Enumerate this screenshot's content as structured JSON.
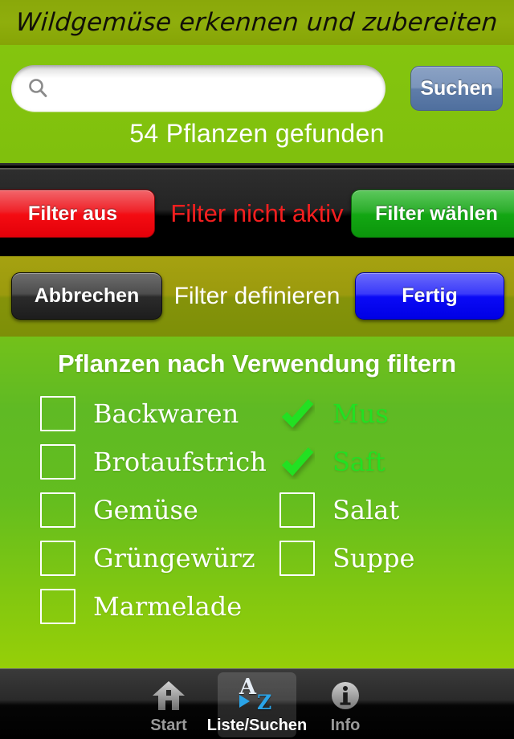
{
  "window": {
    "title": "Wildgemüse erkennen und zubereiten"
  },
  "search": {
    "input_value": "",
    "placeholder": "",
    "icon": "search-icon",
    "button_label": "Suchen",
    "results_text": "54 Pflanzen gefunden"
  },
  "filter_status_bar": {
    "off_button_label": "Filter aus",
    "status_text": "Filter nicht aktiv",
    "choose_button_label": "Filter wählen",
    "status_color": "#f31f1f",
    "off_button_color": "#ef2229",
    "choose_button_color": "#2bae2b"
  },
  "filter_define_bar": {
    "cancel_label": "Abbrechen",
    "title": "Filter definieren",
    "done_label": "Fertig",
    "done_button_color": "#0a0af6"
  },
  "filter_panel": {
    "heading": "Pflanzen nach Verwendung filtern",
    "checked_color": "#22e022",
    "columns": [
      {
        "options": [
          {
            "label": "Backwaren",
            "checked": false
          },
          {
            "label": "Brotaufstrich",
            "checked": false
          },
          {
            "label": "Gemüse",
            "checked": false
          },
          {
            "label": "Grüngewürz",
            "checked": false
          },
          {
            "label": "Marmelade",
            "checked": false
          }
        ]
      },
      {
        "options": [
          {
            "label": "Mus",
            "checked": true
          },
          {
            "label": "Saft",
            "checked": true
          },
          {
            "label": "Salat",
            "checked": false
          },
          {
            "label": "Suppe",
            "checked": false
          }
        ]
      }
    ]
  },
  "tabbar": {
    "tabs": [
      {
        "label": "Start",
        "icon": "home-icon",
        "active": false
      },
      {
        "label": "Liste/Suchen",
        "icon": "a-to-z-icon",
        "active": true
      },
      {
        "label": "Info",
        "icon": "info-icon",
        "active": false
      }
    ]
  }
}
